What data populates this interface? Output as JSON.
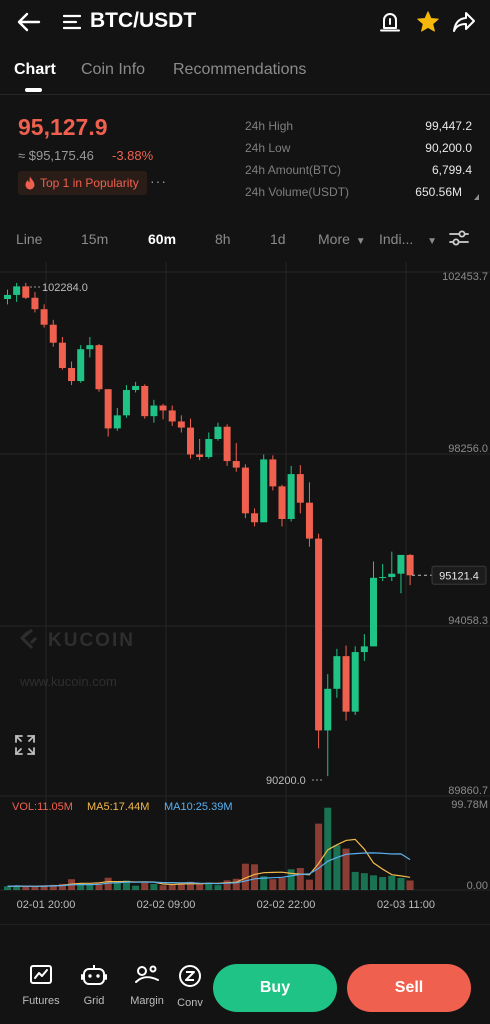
{
  "header": {
    "pair": "BTC/USDT",
    "icons": [
      "back-arrow-icon",
      "menu-icon",
      "alert-bell-icon",
      "star-icon",
      "share-icon"
    ]
  },
  "tabs": [
    {
      "label": "Chart",
      "active": true
    },
    {
      "label": "Coin Info",
      "active": false
    },
    {
      "label": "Recommendations",
      "active": false
    }
  ],
  "ticker": {
    "last_price": "95,127.9",
    "usd_price": "≈ $95,175.46",
    "change": "-3.88%",
    "popularity": "Top 1 in Popularity",
    "more": "···",
    "stats": [
      {
        "label": "24h High",
        "value": "99,447.2"
      },
      {
        "label": "24h Low",
        "value": "90,200.0"
      },
      {
        "label": "24h Amount(BTC)",
        "value": "6,799.4"
      },
      {
        "label": "24h Volume(USDT)",
        "value": "650.56M"
      }
    ]
  },
  "intervals": [
    {
      "label": "Line",
      "active": false
    },
    {
      "label": "15m",
      "active": false
    },
    {
      "label": "60m",
      "active": true
    },
    {
      "label": "8h",
      "active": false
    },
    {
      "label": "1d",
      "active": false
    },
    {
      "label": "More",
      "active": false,
      "dropdown": true
    },
    {
      "label": "Indi...",
      "active": false,
      "dropdown": true
    }
  ],
  "colors": {
    "up": "#1fc386",
    "down": "#f0604f",
    "ma5": "#f2b94a",
    "ma10": "#59b0f0",
    "grid": "#262626"
  },
  "chart": {
    "watermark_brand": "KUCOIN",
    "watermark_url": "www.kucoin.com",
    "max_marker": "102284.0",
    "min_marker": "90200.0",
    "current_price_label": "95121.4",
    "price_labels": [
      "102453.7",
      "98256.0",
      "94058.3",
      "89860.7"
    ],
    "volume_max_label": "99.78M",
    "volume_min_label": "0.00",
    "vol_legend": "VOL:11.05M",
    "ma5_legend": "MA5:17.44M",
    "ma10_legend": "MA10:25.39M",
    "time_labels": [
      "02-01 20:00",
      "02-02 09:00",
      "02-02 22:00",
      "02-03 11:00"
    ]
  },
  "chart_data": {
    "type": "candlestick",
    "price_range": [
      89860.7,
      102453.7
    ],
    "candles": [
      {
        "o": 101890,
        "h": 102120,
        "l": 101760,
        "c": 101990
      },
      {
        "o": 101990,
        "h": 102284,
        "l": 101820,
        "c": 102200
      },
      {
        "o": 102200,
        "h": 102284,
        "l": 101890,
        "c": 101920
      },
      {
        "o": 101920,
        "h": 102060,
        "l": 101560,
        "c": 101640
      },
      {
        "o": 101640,
        "h": 101760,
        "l": 101190,
        "c": 101260
      },
      {
        "o": 101260,
        "h": 101380,
        "l": 100720,
        "c": 100820
      },
      {
        "o": 100820,
        "h": 100960,
        "l": 100160,
        "c": 100200
      },
      {
        "o": 100200,
        "h": 100360,
        "l": 99780,
        "c": 99880
      },
      {
        "o": 99880,
        "h": 100760,
        "l": 99840,
        "c": 100660
      },
      {
        "o": 100660,
        "h": 100960,
        "l": 100460,
        "c": 100760
      },
      {
        "o": 100760,
        "h": 100790,
        "l": 99620,
        "c": 99680
      },
      {
        "o": 99680,
        "h": 99680,
        "l": 98520,
        "c": 98720
      },
      {
        "o": 98720,
        "h": 99220,
        "l": 98660,
        "c": 99040
      },
      {
        "o": 99040,
        "h": 99780,
        "l": 98980,
        "c": 99660
      },
      {
        "o": 99660,
        "h": 99860,
        "l": 99600,
        "c": 99760
      },
      {
        "o": 99760,
        "h": 99800,
        "l": 98960,
        "c": 99020
      },
      {
        "o": 99020,
        "h": 99420,
        "l": 98860,
        "c": 99280
      },
      {
        "o": 99280,
        "h": 99320,
        "l": 98940,
        "c": 99160
      },
      {
        "o": 99160,
        "h": 99280,
        "l": 98780,
        "c": 98890
      },
      {
        "o": 98890,
        "h": 99040,
        "l": 98620,
        "c": 98740
      },
      {
        "o": 98740,
        "h": 98960,
        "l": 97980,
        "c": 98080
      },
      {
        "o": 98080,
        "h": 98460,
        "l": 97940,
        "c": 98020
      },
      {
        "o": 98020,
        "h": 98620,
        "l": 97980,
        "c": 98460
      },
      {
        "o": 98460,
        "h": 98860,
        "l": 98420,
        "c": 98760
      },
      {
        "o": 98760,
        "h": 98820,
        "l": 97800,
        "c": 97920
      },
      {
        "o": 97920,
        "h": 98360,
        "l": 97660,
        "c": 97760
      },
      {
        "o": 97760,
        "h": 97840,
        "l": 96520,
        "c": 96640
      },
      {
        "o": 96640,
        "h": 96760,
        "l": 96320,
        "c": 96420
      },
      {
        "o": 96420,
        "h": 98080,
        "l": 96420,
        "c": 97960
      },
      {
        "o": 97960,
        "h": 98060,
        "l": 97200,
        "c": 97300
      },
      {
        "o": 97300,
        "h": 97340,
        "l": 96320,
        "c": 96500
      },
      {
        "o": 96500,
        "h": 97800,
        "l": 96440,
        "c": 97600
      },
      {
        "o": 97600,
        "h": 97820,
        "l": 96640,
        "c": 96900
      },
      {
        "o": 96900,
        "h": 97400,
        "l": 95820,
        "c": 96020
      },
      {
        "o": 96020,
        "h": 96140,
        "l": 90880,
        "c": 91320
      },
      {
        "o": 91320,
        "h": 92700,
        "l": 90200,
        "c": 92340
      },
      {
        "o": 92340,
        "h": 93320,
        "l": 92120,
        "c": 93140
      },
      {
        "o": 93140,
        "h": 93400,
        "l": 91560,
        "c": 91780
      },
      {
        "o": 91780,
        "h": 93380,
        "l": 91700,
        "c": 93240
      },
      {
        "o": 93240,
        "h": 93680,
        "l": 93020,
        "c": 93380
      },
      {
        "o": 93380,
        "h": 95460,
        "l": 93380,
        "c": 95060
      },
      {
        "o": 95060,
        "h": 95400,
        "l": 94980,
        "c": 95080
      },
      {
        "o": 95080,
        "h": 95700,
        "l": 94980,
        "c": 95160
      },
      {
        "o": 95160,
        "h": 95580,
        "l": 94680,
        "c": 95620
      },
      {
        "o": 95620,
        "h": 95640,
        "l": 94880,
        "c": 95121
      }
    ],
    "volume_range": [
      0,
      99.78
    ],
    "volumes": [
      4.2,
      5.1,
      4.0,
      3.8,
      5.5,
      6.0,
      7.1,
      12.5,
      8.0,
      6.5,
      7.5,
      14.2,
      9.0,
      11.0,
      5.0,
      8.5,
      7.0,
      5.5,
      6.2,
      7.8,
      9.5,
      6.8,
      8.5,
      5.6,
      11.2,
      13.0,
      30.5,
      29.8,
      16.0,
      12.5,
      14.0,
      24.0,
      25.5,
      12.0,
      77.0,
      95.5,
      52.0,
      48.0,
      21.0,
      19.5,
      17.0,
      15.0,
      16.5,
      14.0,
      11.05
    ],
    "ma5": [
      4.2,
      4.6,
      4.4,
      4.3,
      4.5,
      4.9,
      5.3,
      6.9,
      7.8,
      7.8,
      8.3,
      9.7,
      9.8,
      9.8,
      9.3,
      9.5,
      9.3,
      7.0,
      6.4,
      7.0,
      7.2,
      7.2,
      7.6,
      7.6,
      8.5,
      9.1,
      13.8,
      18.1,
      20.1,
      20.4,
      20.6,
      19.3,
      18.4,
      17.6,
      30.7,
      46.6,
      52.4,
      57.5,
      58.7,
      47.2,
      31.5,
      24.1,
      17.8,
      16.4,
      14.7
    ],
    "ma10": [
      4.2,
      4.6,
      4.4,
      4.3,
      4.5,
      4.8,
      5.1,
      6.0,
      6.3,
      6.3,
      6.6,
      7.9,
      8.4,
      9.1,
      9.1,
      9.2,
      9.2,
      8.6,
      8.6,
      8.3,
      8.5,
      7.9,
      7.8,
      7.3,
      7.9,
      8.4,
      10.6,
      13.0,
      13.8,
      14.3,
      14.7,
      16.4,
      18.1,
      18.7,
      25.2,
      33.4,
      37.6,
      41.4,
      42.2,
      42.9,
      43.1,
      42.6,
      41.8,
      41.9,
      35.3
    ],
    "current_price": 95121.4,
    "marked_high": 102284.0,
    "marked_low": 90200.0
  },
  "bottom_nav": [
    {
      "label": "Futures",
      "icon": "futures-chart-icon"
    },
    {
      "label": "Grid",
      "icon": "grid-bot-icon"
    },
    {
      "label": "Margin",
      "icon": "margin-scale-icon"
    },
    {
      "label": "Conv",
      "icon": "convert-icon"
    }
  ],
  "actions": {
    "buy": "Buy",
    "sell": "Sell"
  }
}
